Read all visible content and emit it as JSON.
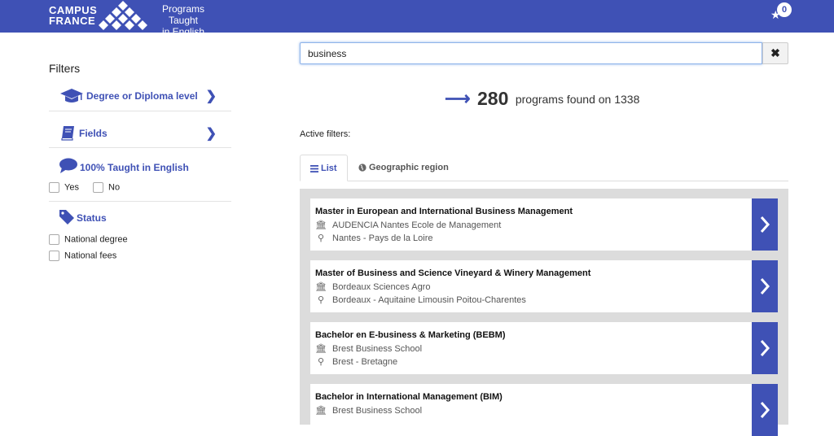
{
  "header": {
    "logo_line1": "CAMPUS",
    "logo_line2": "FRANCE",
    "subtitle_line1": "Programs Taught",
    "subtitle_line2": "in English",
    "favorites_count": "0",
    "brand_color": "#3f51b5"
  },
  "sidebar": {
    "title": "Filters",
    "filters": [
      {
        "label": "Degree or Diploma level",
        "icon": "graduation-cap-icon"
      },
      {
        "label": "Fields",
        "icon": "book-icon"
      },
      {
        "label": "100% Taught in English",
        "icon": "speech-bubble-icon"
      },
      {
        "label": "Status",
        "icon": "tag-icon"
      }
    ],
    "english_options": [
      "Yes",
      "No"
    ],
    "status_options": [
      "National degree",
      "National fees"
    ]
  },
  "search": {
    "value": "business",
    "clear_icon": "close-icon"
  },
  "results": {
    "count": "280",
    "suffix": "programs found on 1338"
  },
  "active_filters_label": "Active filters:",
  "tabs": [
    {
      "label": "List",
      "icon": "list-icon",
      "active": true
    },
    {
      "label": "Geographic region",
      "icon": "globe-icon",
      "active": false
    }
  ],
  "programs": [
    {
      "title": "Master in European and International Business Management",
      "school": "AUDENCIA Nantes Ecole de Management",
      "location": "Nantes - Pays de la Loire"
    },
    {
      "title": "Master of Business and Science Vineyard & Winery Management",
      "school": "Bordeaux Sciences Agro",
      "location": "Bordeaux - Aquitaine Limousin Poitou-Charentes"
    },
    {
      "title": "Bachelor en E-business & Marketing (BEBM)",
      "school": "Brest Business School",
      "location": "Brest - Bretagne"
    },
    {
      "title": "Bachelor in International Management (BIM)",
      "school": "Brest Business School",
      "location": ""
    }
  ]
}
